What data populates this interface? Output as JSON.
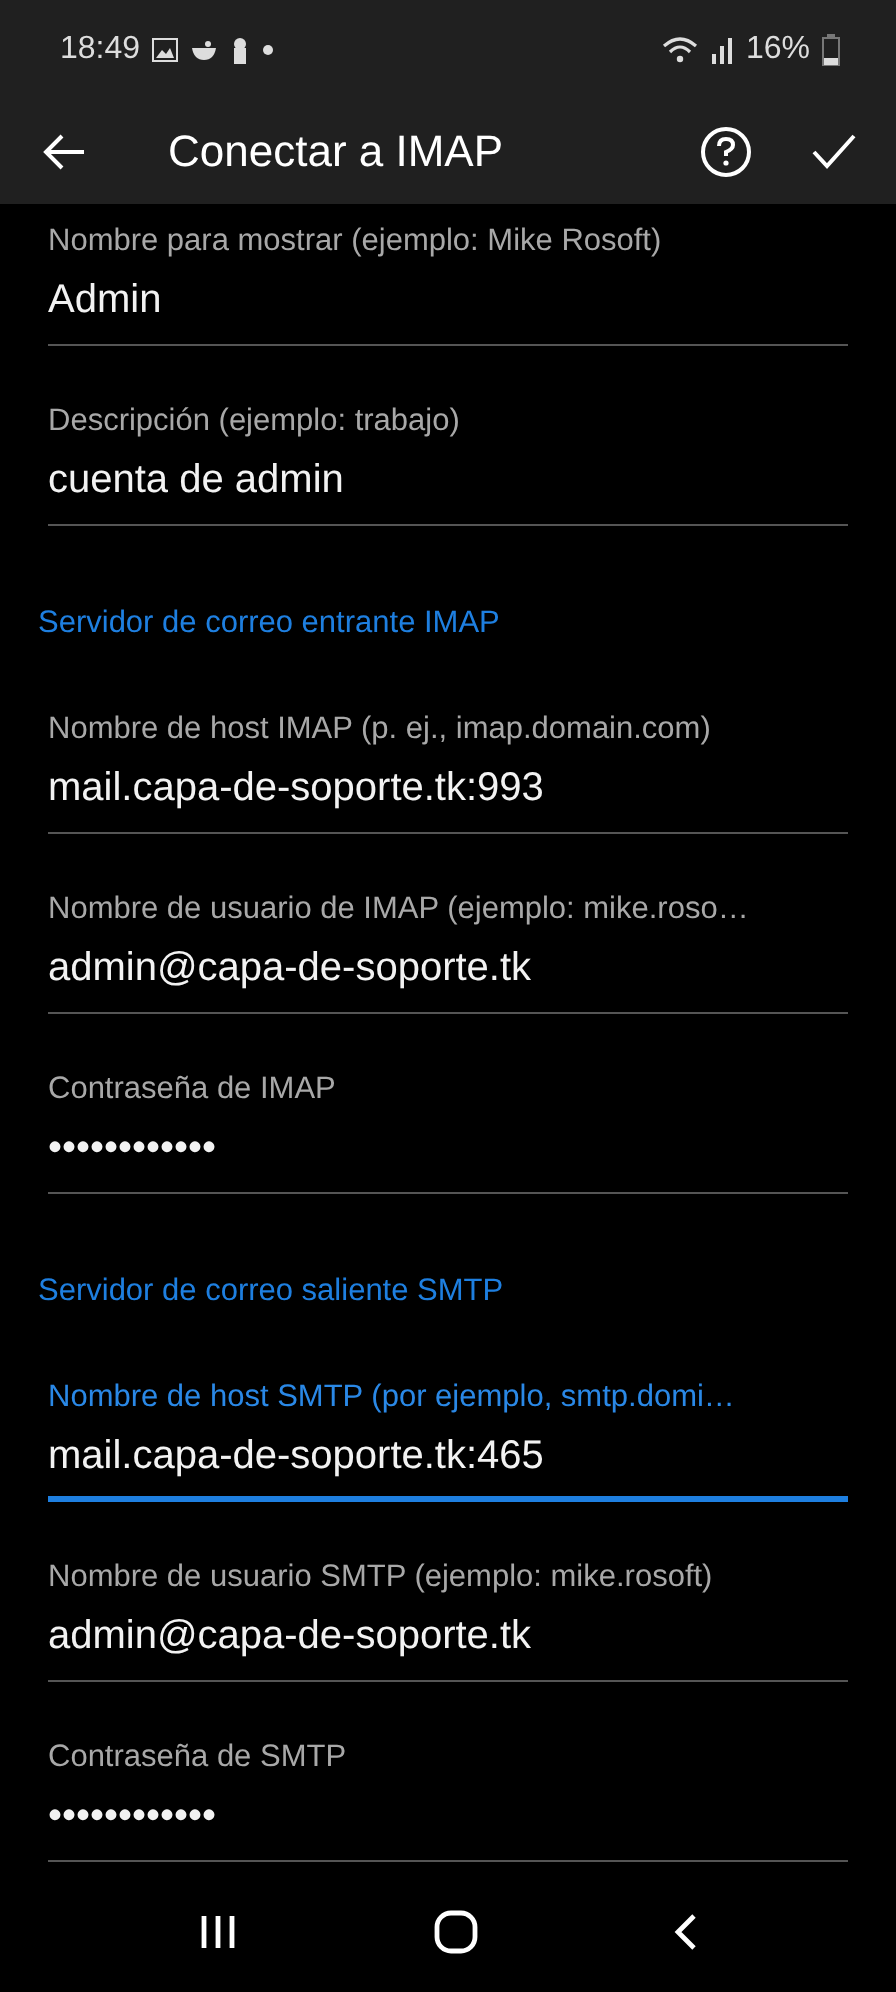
{
  "status_bar": {
    "time": "18:49",
    "battery": "16%"
  },
  "header": {
    "title": "Conectar a IMAP"
  },
  "sections": [
    {
      "fields": [
        {
          "label": "Nombre para mostrar (ejemplo: Mike Rosoft)",
          "value": "Admin",
          "focused": false
        },
        {
          "label": "Descripción (ejemplo: trabajo)",
          "value": "cuenta de admin",
          "focused": false
        }
      ]
    },
    {
      "title": "Servidor de correo entrante IMAP",
      "fields": [
        {
          "label": "Nombre de host IMAP (p. ej., imap.domain.com)",
          "value": "mail.capa-de-soporte.tk:993",
          "focused": false
        },
        {
          "label": "Nombre de usuario de IMAP (ejemplo: mike.roso…",
          "value": "admin@capa-de-soporte.tk",
          "focused": false
        },
        {
          "label": "Contraseña de IMAP",
          "value": "••••••••••••",
          "focused": false
        }
      ]
    },
    {
      "title": "Servidor de correo saliente SMTP",
      "fields": [
        {
          "label": "Nombre de host SMTP (por ejemplo, smtp.domi…",
          "value": "mail.capa-de-soporte.tk:465",
          "focused": true
        },
        {
          "label": "Nombre de usuario SMTP (ejemplo: mike.rosoft)",
          "value": "admin@capa-de-soporte.tk",
          "focused": false
        },
        {
          "label": "Contraseña de SMTP",
          "value": "••••••••••••",
          "focused": false
        }
      ]
    }
  ]
}
